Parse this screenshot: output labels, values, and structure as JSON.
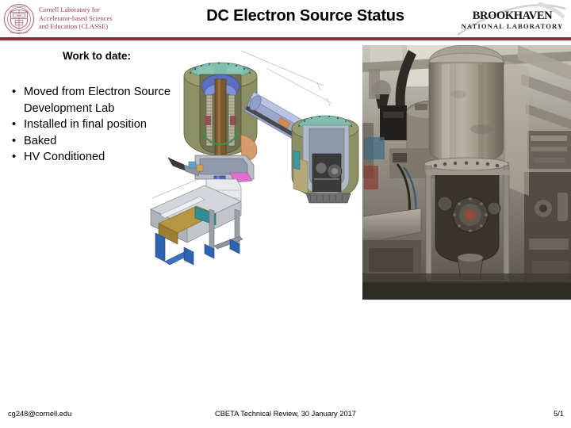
{
  "header": {
    "cornell_logo": {
      "seal_icon": "cornell-seal-icon",
      "lab_text": "Cornell Laboratory for\nAccelerator-based Sciences\nand Education (CLASSE)"
    },
    "title": "DC Electron Source Status",
    "bnl_logo": {
      "name": "BROOKHAVEN",
      "subtitle": "NATIONAL LABORATORY",
      "swoosh_icon": "swoosh-icon"
    },
    "rule_color": "#8b2b36"
  },
  "content": {
    "work_heading": "Work to date:",
    "bullets": [
      "Moved from Electron Source Development Lab",
      "Installed in final position",
      "Baked",
      "HV Conditioned"
    ],
    "bullet_marker": "•",
    "cad_figure": {
      "name": "dc-electron-gun-cad-section-view",
      "colors": {
        "vessel_body": "#8d8f64",
        "vessel_top": "#7fbdad",
        "beamline": "#9aa8cc",
        "support": "#c9ccd1",
        "frame_blue": "#3a6fb5",
        "inner_bronze": "#7a5a2e"
      }
    },
    "photo_figure": {
      "name": "dc-gun-installed-photograph",
      "colors": {
        "vessel": "#9a958b",
        "background": "#6e6a60",
        "floor": "#3c382f"
      }
    }
  },
  "footer": {
    "email": "cg248@cornell.edu",
    "center": "CBETA Technical Review, 30 January 2017",
    "page": "5/1"
  }
}
